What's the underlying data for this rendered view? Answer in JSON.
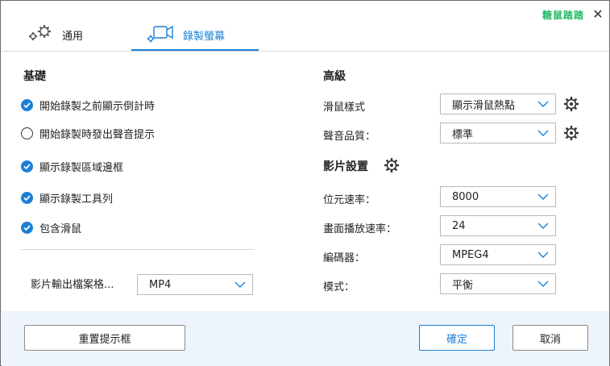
{
  "header": {
    "brand_text": "糖鼠踏踏",
    "tabs": [
      {
        "label": "通用",
        "active": false
      },
      {
        "label": "錄製螢幕",
        "active": true
      }
    ]
  },
  "basic": {
    "title": "基礎",
    "options": [
      {
        "label": "開始錄製之前顯示倒計時",
        "checked": true
      },
      {
        "label": "開始錄製時發出聲音提示",
        "checked": false
      },
      {
        "label": "顯示錄製區域邊框",
        "checked": true
      },
      {
        "label": "顯示錄製工具列",
        "checked": true
      },
      {
        "label": "包含滑鼠",
        "checked": true
      }
    ],
    "output_format": {
      "label": "影片輸出檔案格...",
      "value": "MP4"
    }
  },
  "advanced": {
    "title": "高級",
    "mouse_style": {
      "label": "滑鼠樣式",
      "value": "顯示滑鼠熱點"
    },
    "audio_quality": {
      "label": "聲音品質：",
      "value": "標準"
    }
  },
  "video": {
    "title": "影片設置",
    "bitrate": {
      "label": "位元速率：",
      "value": "8000"
    },
    "framerate": {
      "label": "畫面播放速率：",
      "value": "24"
    },
    "encoder": {
      "label": "編碼器：",
      "value": "MPEG4"
    },
    "mode": {
      "label": "模式：",
      "value": "平衡"
    }
  },
  "footer": {
    "reset_label": "重置提示框",
    "ok_label": "確定",
    "cancel_label": "取消"
  },
  "colors": {
    "accent": "#1c7fd6",
    "brand": "#27b86a",
    "footer_bg": "#eef4fb"
  }
}
